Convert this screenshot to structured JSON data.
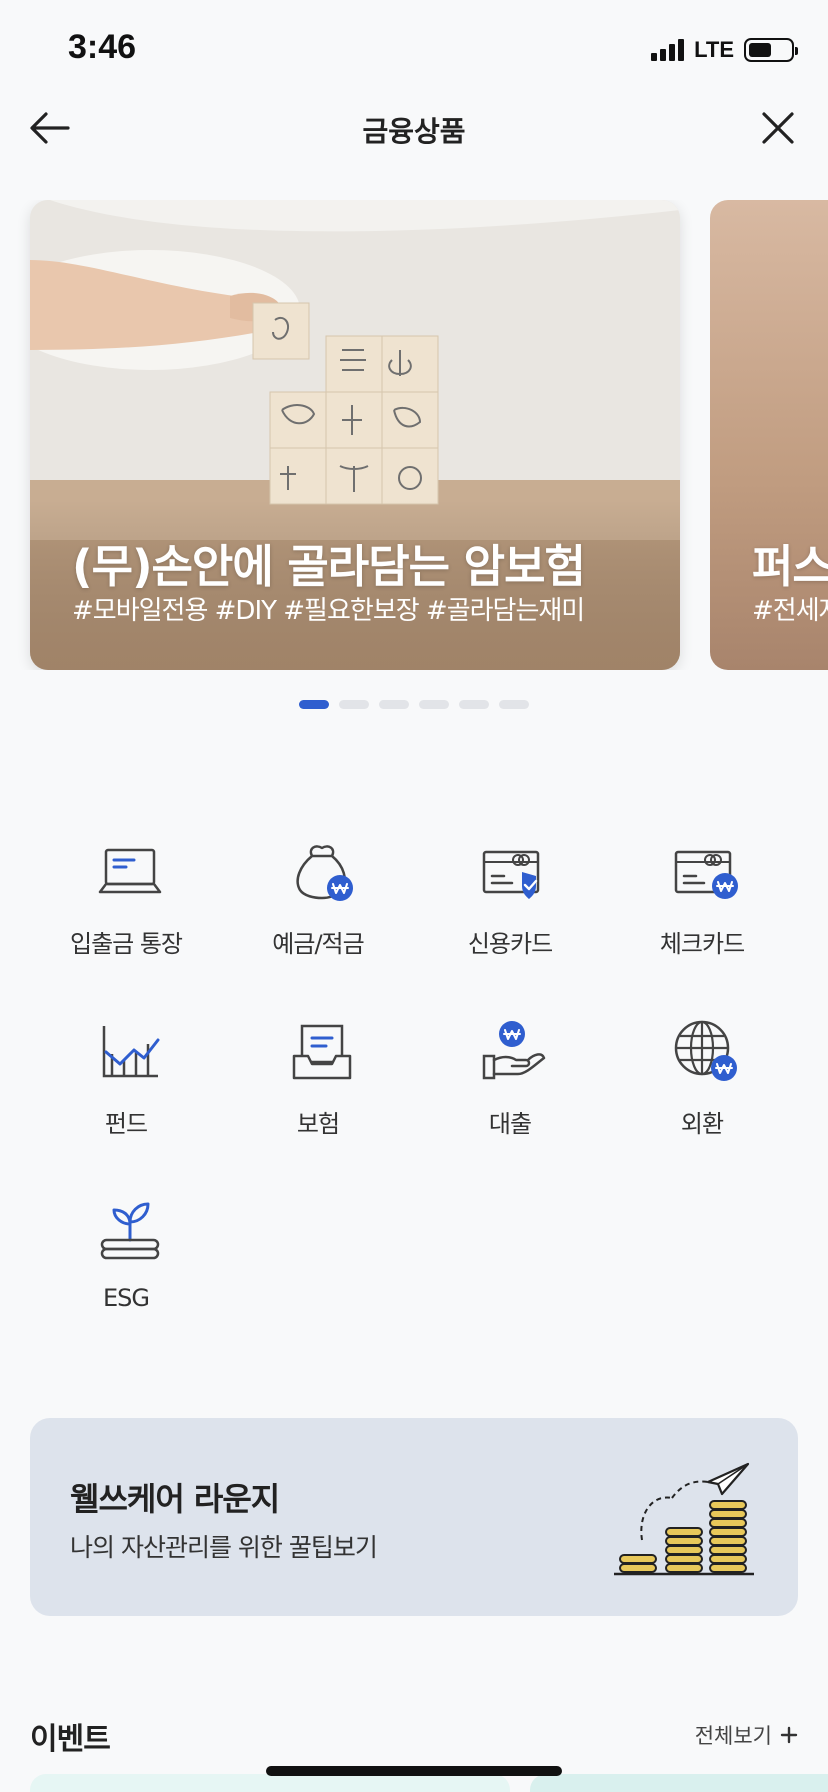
{
  "status": {
    "time": "3:46",
    "network": "LTE"
  },
  "nav": {
    "title": "금융상품"
  },
  "carousel": {
    "slides": [
      {
        "title": "(무)손안에 골라담는 암보험",
        "tags": "#모바일전용 #DIY #필요한보장 #골라담는재미"
      },
      {
        "title": "퍼스",
        "tags": "#전세자"
      }
    ],
    "active_index": 0,
    "total": 6
  },
  "products": [
    {
      "label": "입출금 통장",
      "icon": "laptop-icon"
    },
    {
      "label": "예금/적금",
      "icon": "money-bag-icon"
    },
    {
      "label": "신용카드",
      "icon": "credit-card-shield-icon"
    },
    {
      "label": "체크카드",
      "icon": "check-card-icon"
    },
    {
      "label": "펀드",
      "icon": "chart-icon"
    },
    {
      "label": "보험",
      "icon": "insurance-document-icon"
    },
    {
      "label": "대출",
      "icon": "loan-hand-icon"
    },
    {
      "label": "외환",
      "icon": "globe-exchange-icon"
    },
    {
      "label": "ESG",
      "icon": "sprout-icon"
    }
  ],
  "banner": {
    "title": "웰쓰케어 라운지",
    "subtitle": "나의 자산관리를 위한 꿀팁보기",
    "icon": "coins-plane-icon"
  },
  "events": {
    "title": "이벤트",
    "more_label": "전체보기"
  },
  "colors": {
    "accent": "#2f5ecf",
    "icon_stroke": "#444444",
    "banner_bg": "#dde3ec"
  }
}
